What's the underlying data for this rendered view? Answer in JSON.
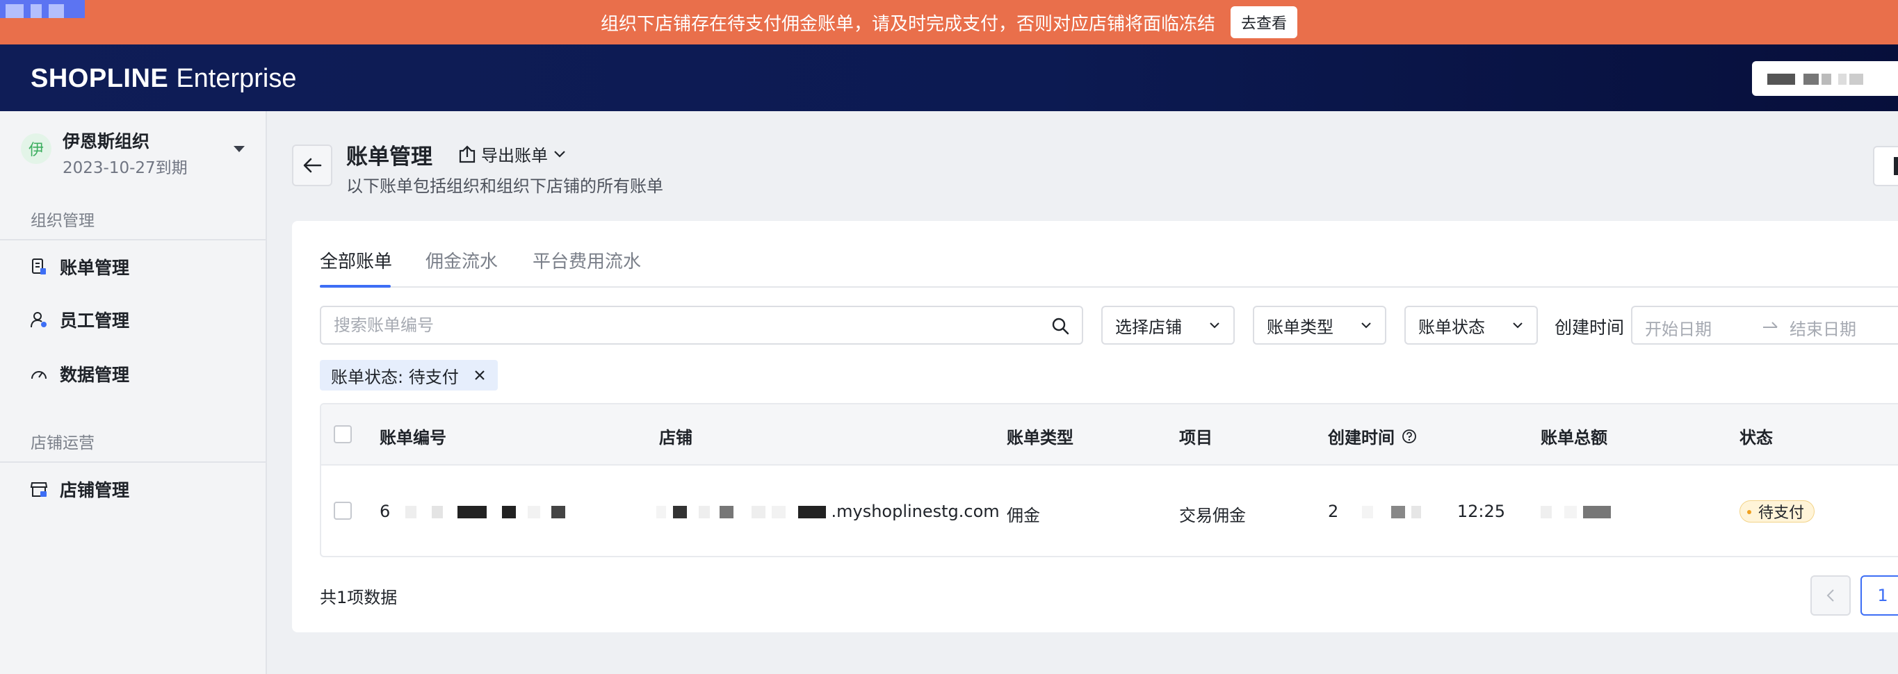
{
  "banner": {
    "message": "组织下店铺存在待支付佣金账单，请及时完成支付，否则对应店铺将面临冻结",
    "action_label": "去查看"
  },
  "header": {
    "logo_brand": "SHOPLINE",
    "logo_suffix": "Enterprise"
  },
  "sidebar": {
    "org": {
      "avatar_char": "伊",
      "name": "伊恩斯组织",
      "expiry": "2023-10-27到期"
    },
    "sections": [
      {
        "title": "组织管理",
        "items": [
          {
            "label": "账单管理",
            "icon": "bill-icon"
          },
          {
            "label": "员工管理",
            "icon": "user-settings-icon"
          },
          {
            "label": "数据管理",
            "icon": "gauge-icon"
          }
        ]
      },
      {
        "title": "店铺运营",
        "items": [
          {
            "label": "店铺管理",
            "icon": "store-icon"
          }
        ]
      }
    ]
  },
  "page": {
    "title": "账单管理",
    "export_label": "导出账单",
    "subtitle": "以下账单包括组织和组织下店铺的所有账单"
  },
  "tabs": [
    {
      "label": "全部账单",
      "active": true
    },
    {
      "label": "佣金流水",
      "active": false
    },
    {
      "label": "平台费用流水",
      "active": false
    }
  ],
  "filters": {
    "search_placeholder": "搜索账单编号",
    "store_select": "选择店铺",
    "type_select": "账单类型",
    "status_select": "账单状态",
    "created_time_label": "创建时间",
    "start_date_placeholder": "开始日期",
    "end_date_placeholder": "结束日期",
    "active_tag": "账单状态: 待支付"
  },
  "table": {
    "columns": [
      "账单编号",
      "店铺",
      "账单类型",
      "项目",
      "创建时间",
      "账单总额",
      "状态"
    ],
    "rows": [
      {
        "bill_no_visible": "6",
        "store_suffix": ".myshoplinestg.com",
        "type": "佣金",
        "item": "交易佣金",
        "created_prefix": "2",
        "created_time": "12:25",
        "status": "待支付"
      }
    ]
  },
  "pagination": {
    "total_text": "共1项数据",
    "current_page": "1"
  },
  "colors": {
    "banner_bg": "#e96f4b",
    "header_bg": "#0c1a52",
    "accent": "#3d6ef5",
    "pending_badge_bg": "#fff4d8"
  }
}
